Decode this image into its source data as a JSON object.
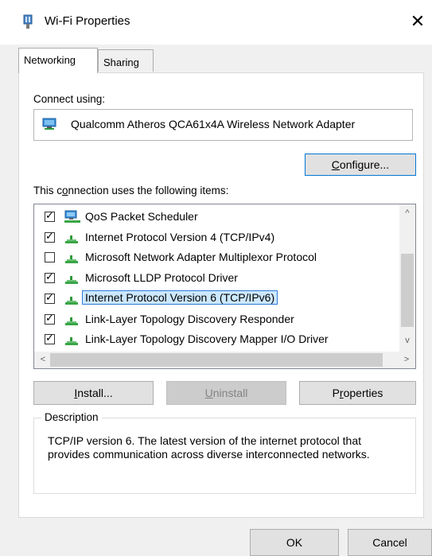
{
  "window": {
    "title": "Wi-Fi Properties",
    "close_glyph": "✕"
  },
  "tabs": [
    {
      "label": "Networking",
      "active": true
    },
    {
      "label": "Sharing",
      "active": false
    }
  ],
  "connect_using": {
    "label": "Connect using:",
    "adapter_name": "Qualcomm Atheros QCA61x4A Wireless Network Adapter",
    "icon": "network-adapter-icon"
  },
  "configure_button": {
    "pre": "",
    "accel": "C",
    "post": "onfigure..."
  },
  "items_label": {
    "pre": "This c",
    "accel": "o",
    "post": "nnection uses the following items:"
  },
  "items": [
    {
      "label": "QoS Packet Scheduler",
      "checked": true,
      "icon": "qos-scheduler-icon"
    },
    {
      "label": "Internet Protocol Version 4 (TCP/IPv4)",
      "checked": true,
      "icon": "protocol-icon"
    },
    {
      "label": "Microsoft Network Adapter Multiplexor Protocol",
      "checked": false,
      "icon": "protocol-icon"
    },
    {
      "label": "Microsoft LLDP Protocol Driver",
      "checked": true,
      "icon": "protocol-icon"
    },
    {
      "label": "Internet Protocol Version 6 (TCP/IPv6)",
      "checked": true,
      "icon": "protocol-icon",
      "selected": true
    },
    {
      "label": "Link-Layer Topology Discovery Responder",
      "checked": true,
      "icon": "protocol-icon"
    },
    {
      "label": "Link-Layer Topology Discovery Mapper I/O Driver",
      "checked": true,
      "icon": "protocol-icon"
    }
  ],
  "buttons": {
    "install": {
      "pre": "",
      "accel": "I",
      "post": "nstall..."
    },
    "uninstall": {
      "pre": "",
      "accel": "U",
      "post": "ninstall"
    },
    "properties": {
      "pre": "P",
      "accel": "r",
      "post": "operties"
    },
    "ok": "OK",
    "cancel": "Cancel"
  },
  "description": {
    "title": "Description",
    "text": "TCP/IP version 6. The latest version of the internet protocol that provides communication across diverse interconnected networks."
  },
  "scroll": {
    "up": "^",
    "down": "v",
    "left": "<",
    "right": ">"
  },
  "colors": {
    "selection_bg": "#cce8ff",
    "selection_border": "#2f7bd8",
    "focus_border": "#0078d7"
  }
}
